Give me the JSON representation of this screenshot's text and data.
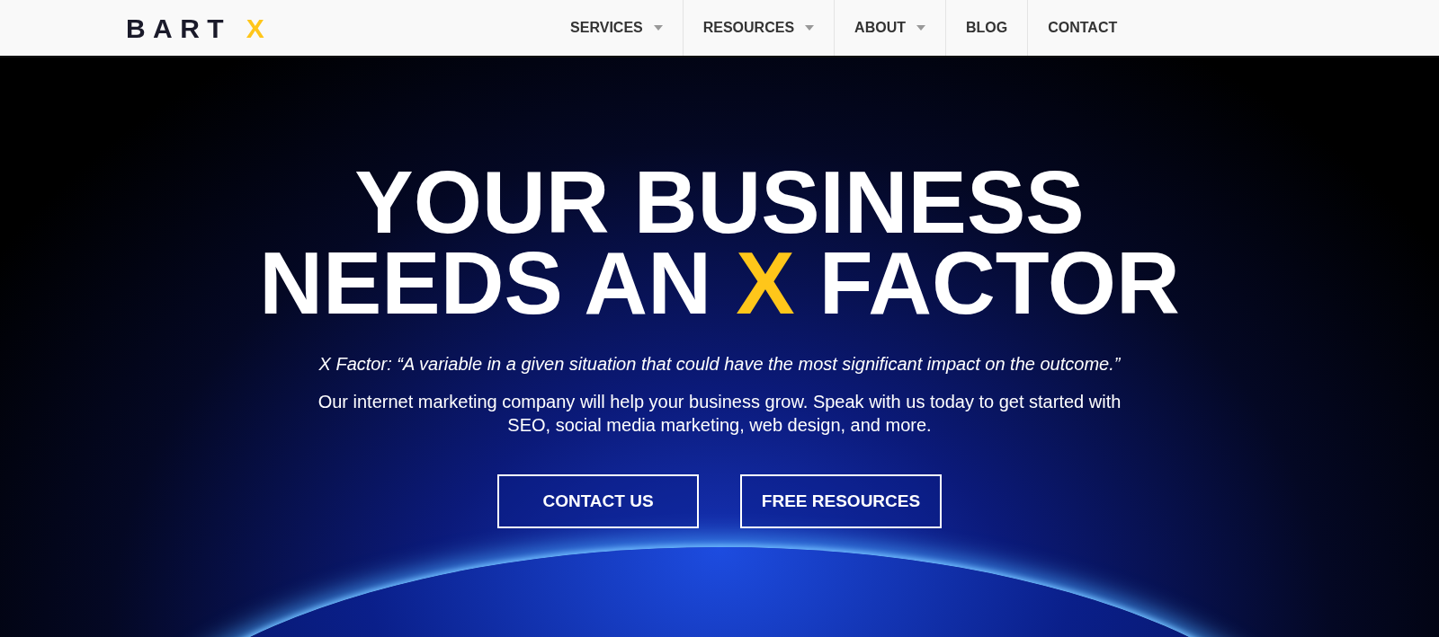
{
  "logo": [
    {
      "text": "BART",
      "accent": false
    },
    {
      "text": "X",
      "accent": true
    }
  ],
  "nav": [
    {
      "label": "SERVICES",
      "dropdown": true
    },
    {
      "label": "RESOURCES",
      "dropdown": true
    },
    {
      "label": "ABOUT",
      "dropdown": true
    },
    {
      "label": "BLOG",
      "dropdown": false
    },
    {
      "label": "CONTACT",
      "dropdown": false
    }
  ],
  "hero": {
    "headline": [
      {
        "text": "YOUR BUSINESS\nNEEDS AN ",
        "accent": false
      },
      {
        "text": "X",
        "accent": true
      },
      {
        "text": " FACTOR",
        "accent": false
      }
    ],
    "quote": "X Factor: “A variable in a given situation that could have the most significant impact on the outcome.”",
    "description": "Our internet marketing company will help your business grow. Speak with us today to get started with SEO, social media marketing, web design, and more.",
    "buttons": [
      "CONTACT US",
      "FREE RESOURCES"
    ]
  }
}
